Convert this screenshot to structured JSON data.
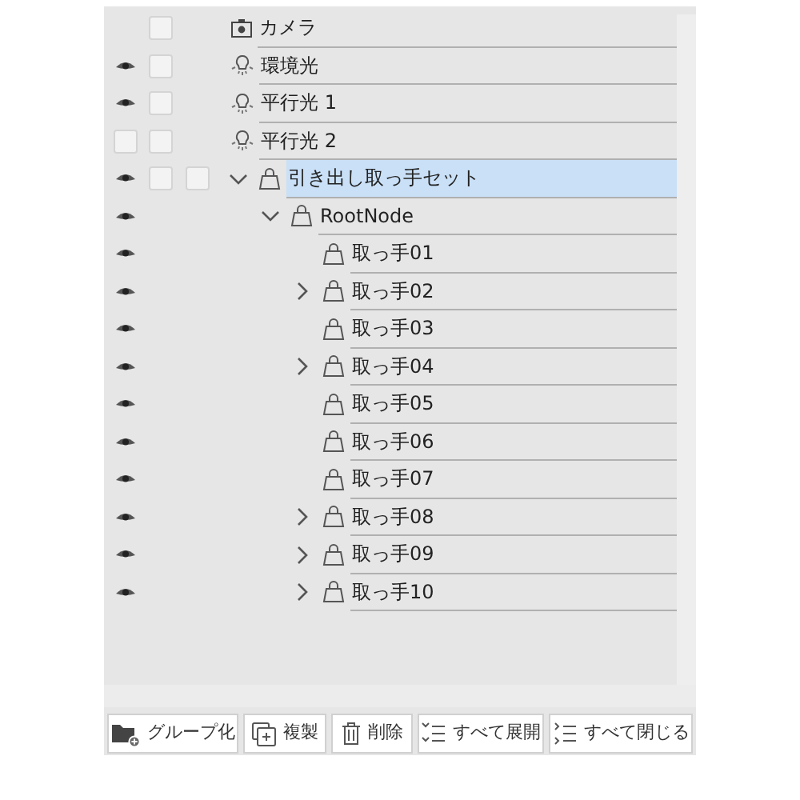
{
  "rows": [
    {
      "kind": "camera",
      "label": "カメラ",
      "lock_box": true
    },
    {
      "kind": "light",
      "label": "環境光",
      "visible": true,
      "lock_box": true
    },
    {
      "kind": "light",
      "label": "平行光 1",
      "visible": true,
      "lock_box": true
    },
    {
      "kind": "light",
      "label": "平行光 2",
      "visible": false,
      "lock_box": true
    },
    {
      "kind": "object",
      "label": "引き出し取っ手セット",
      "visible": true,
      "lock_box": true,
      "extra_box": true,
      "selected": true,
      "expanded": true,
      "children": [
        {
          "kind": "object",
          "label": "RootNode",
          "visible": true,
          "selected": false,
          "expanded": true,
          "children": [
            {
              "kind": "object",
              "label": "取っ手01",
              "visible": true,
              "selected": false
            },
            {
              "kind": "object",
              "label": "取っ手02",
              "visible": true,
              "selected": false,
              "expanded": false
            },
            {
              "kind": "object",
              "label": "取っ手03",
              "visible": true,
              "selected": false
            },
            {
              "kind": "object",
              "label": "取っ手04",
              "visible": true,
              "selected": false,
              "expanded": false
            },
            {
              "kind": "object",
              "label": "取っ手05",
              "visible": true,
              "selected": false
            },
            {
              "kind": "object",
              "label": "取っ手06",
              "visible": true,
              "selected": false
            },
            {
              "kind": "object",
              "label": "取っ手07",
              "visible": true,
              "selected": false
            },
            {
              "kind": "object",
              "label": "取っ手08",
              "visible": true,
              "selected": false,
              "expanded": false
            },
            {
              "kind": "object",
              "label": "取っ手09",
              "visible": true,
              "selected": false,
              "expanded": false
            },
            {
              "kind": "object",
              "label": "取っ手10",
              "visible": true,
              "selected": false,
              "expanded": false
            }
          ]
        }
      ]
    }
  ],
  "buttons": [
    {
      "kind": "group",
      "label": "グループ化"
    },
    {
      "kind": "duplicate",
      "label": "複製"
    },
    {
      "kind": "delete",
      "label": "削除"
    },
    {
      "kind": "expand_all",
      "label": "すべて展開"
    },
    {
      "kind": "collapse_all",
      "label": "すべて閉じる"
    }
  ]
}
